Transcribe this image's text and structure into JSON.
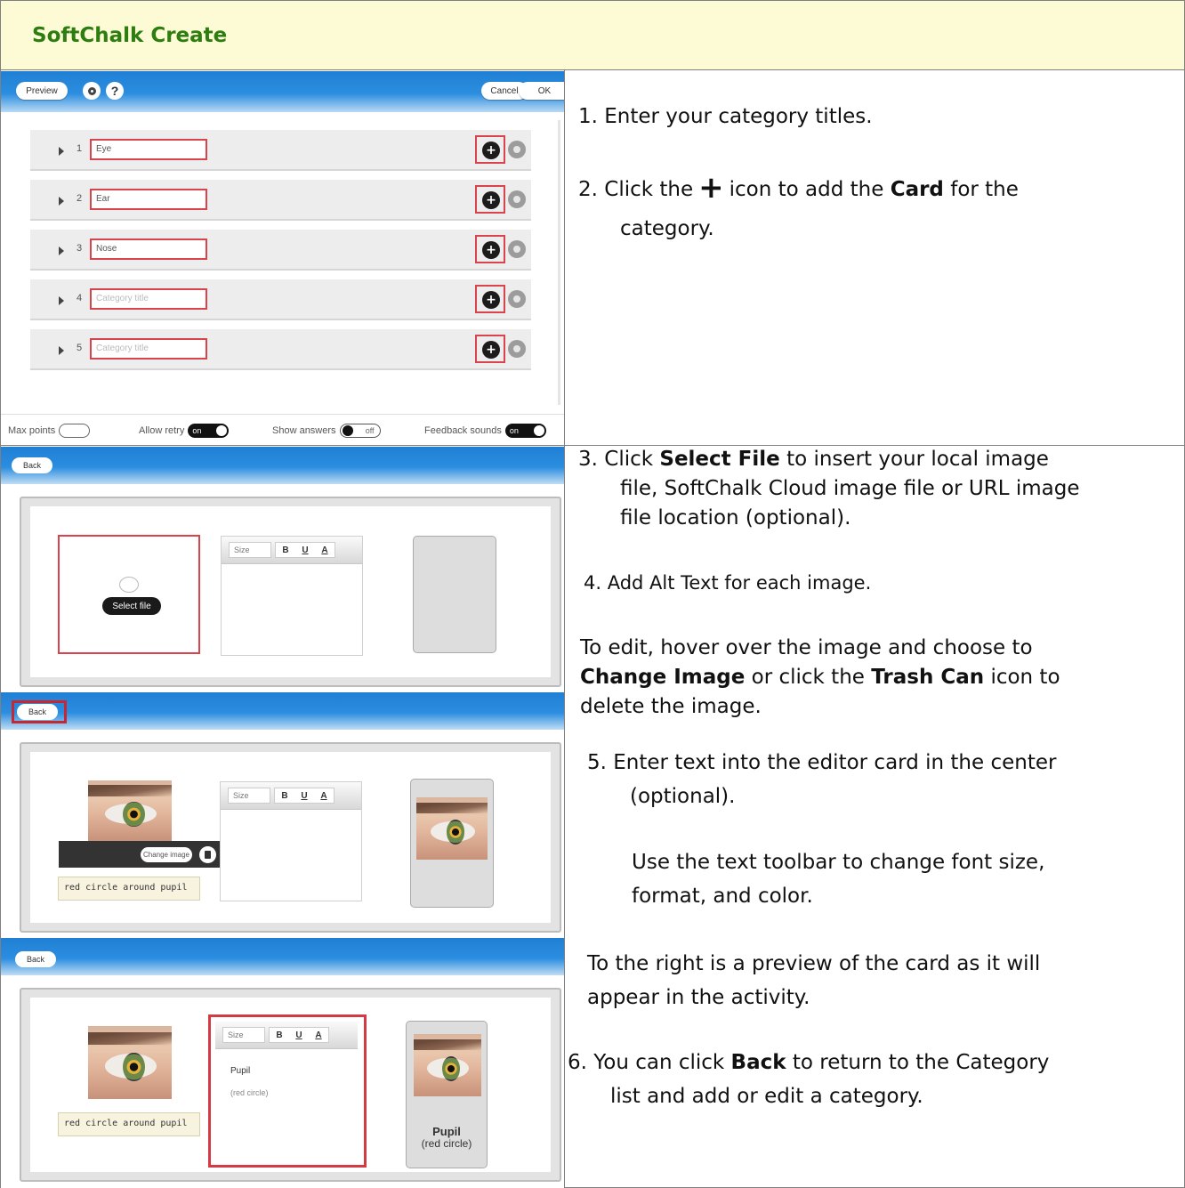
{
  "header": {
    "title": "SoftChalk Create"
  },
  "screen1": {
    "preview_label": "Preview",
    "help_label": "?",
    "cancel_label": "Cancel",
    "ok_label": "OK",
    "rows": [
      {
        "num": "1",
        "value": "Eye",
        "placeholder": false
      },
      {
        "num": "2",
        "value": "Ear",
        "placeholder": false
      },
      {
        "num": "3",
        "value": "Nose",
        "placeholder": false
      },
      {
        "num": "4",
        "value": "Category title",
        "placeholder": true
      },
      {
        "num": "5",
        "value": "Category title",
        "placeholder": true
      }
    ],
    "footer": {
      "max_points": "Max points",
      "allow_retry": "Allow retry",
      "allow_retry_state": "on",
      "show_answers": "Show answers",
      "show_answers_state": "off",
      "feedback_sounds": "Feedback sounds",
      "feedback_sounds_state": "on"
    }
  },
  "editor": {
    "back_label": "Back",
    "select_file_label": "Select file",
    "size_label": "Size",
    "bold": "B",
    "underline": "U",
    "color": "A",
    "change_image_label": "Change image",
    "alt_text": "red circle around pupil",
    "card_title": "Pupil",
    "card_sub": "(red circle)"
  },
  "instructions": {
    "s1": "1.  Enter your category titles.",
    "s2a": "2.  Click the",
    "s2b": "icon to add the",
    "s2c": "Card",
    "s2d": "for the",
    "s2e": "category.",
    "s3a": "3.  Click",
    "s3b": "Select File",
    "s3c": "to insert your local image",
    "s3d": "file, SoftChalk Cloud image file or URL image",
    "s3e": "file location (optional).",
    "s4": "4.  Add Alt Text for each image.",
    "s5a": "To edit, hover over the image and choose to",
    "s5b": "Change Image",
    "s5c": "or click the",
    "s5d": "Trash Can",
    "s5e": "icon to",
    "s5f": "delete the image.",
    "s6a": "5.  Enter text into the editor card in the center",
    "s6b": "(optional).",
    "s7a": "Use the text toolbar to change font size,",
    "s7b": "format, and color.",
    "s8a": "To the right is a preview of the card as it will",
    "s8b": "appear in the activity.",
    "s9a": "6.  You can click",
    "s9b": "Back",
    "s9c": "to return to the Category",
    "s9d": "list and add or edit a category."
  }
}
